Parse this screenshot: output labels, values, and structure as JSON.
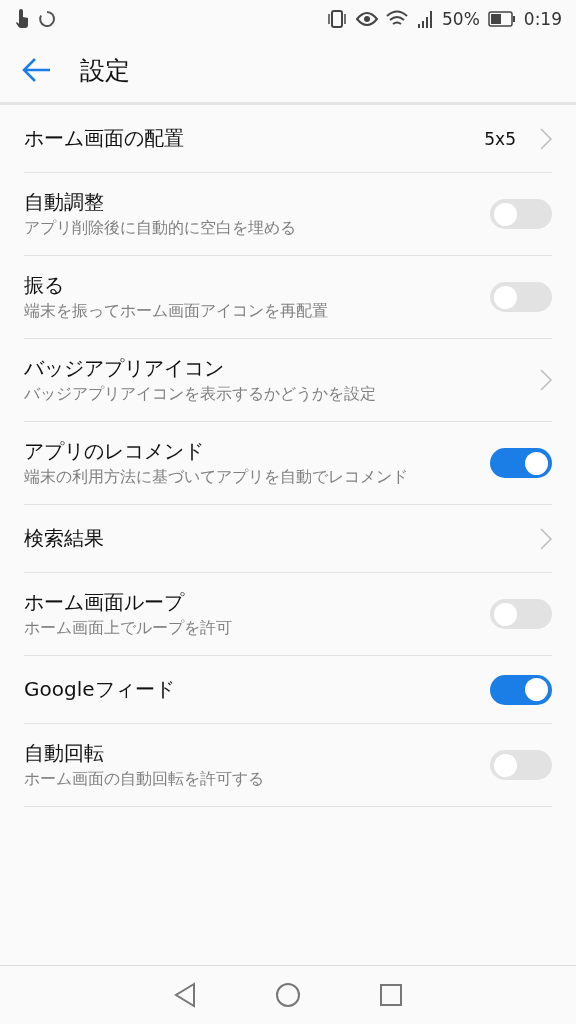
{
  "status_bar": {
    "battery_text": "50%",
    "time": "0:19"
  },
  "header": {
    "title": "設定"
  },
  "settings": [
    {
      "kind": "link",
      "title": "ホーム画面の配置",
      "value": "5x5"
    },
    {
      "kind": "toggle",
      "title": "自動調整",
      "subtitle": "アプリ削除後に自動的に空白を埋める",
      "on": false
    },
    {
      "kind": "toggle",
      "title": "振る",
      "subtitle": "端末を振ってホーム画面アイコンを再配置",
      "on": false
    },
    {
      "kind": "link",
      "title": "バッジアプリアイコン",
      "subtitle": "バッジアプリアイコンを表示するかどうかを設定"
    },
    {
      "kind": "toggle",
      "title": "アプリのレコメンド",
      "subtitle": "端末の利用方法に基づいてアプリを自動でレコメンド",
      "on": true
    },
    {
      "kind": "link",
      "title": "検索結果"
    },
    {
      "kind": "toggle",
      "title": "ホーム画面ループ",
      "subtitle": "ホーム画面上でループを許可",
      "on": false
    },
    {
      "kind": "toggle",
      "title": "Googleフィード",
      "on": true
    },
    {
      "kind": "toggle",
      "title": "自動回転",
      "subtitle": "ホーム画面の自動回転を許可する",
      "on": false
    }
  ]
}
